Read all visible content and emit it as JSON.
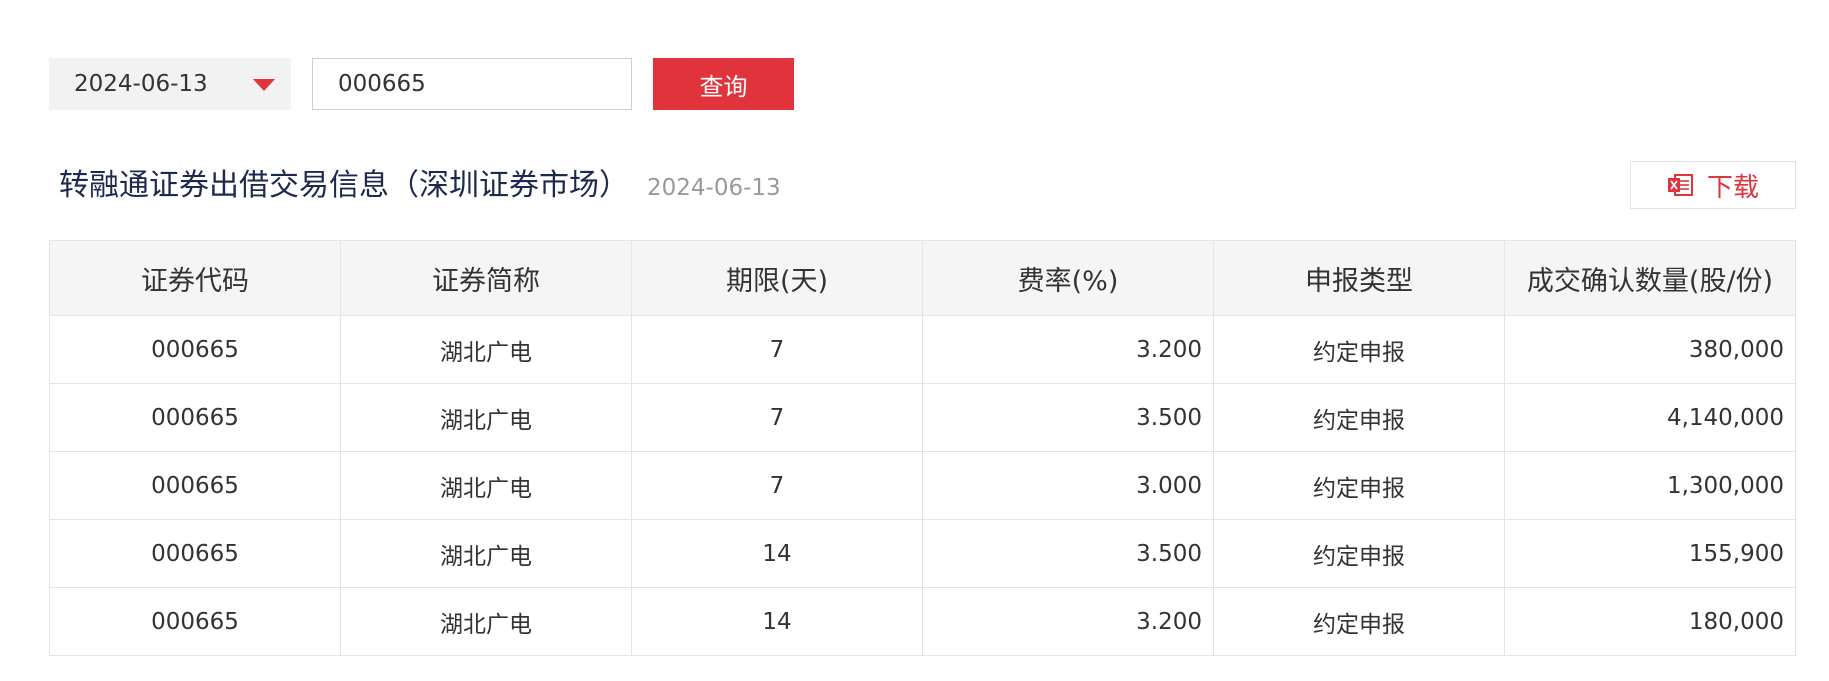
{
  "toolbar": {
    "date_value": "2024-06-13",
    "code_value": "000665",
    "query_label": "查询"
  },
  "header": {
    "title": "转融通证券出借交易信息（深圳证券市场）",
    "date": "2024-06-13",
    "download_label": "下载"
  },
  "colors": {
    "accent": "#e0333b",
    "title": "#1d2a4d",
    "header_bg": "#f5f5f5",
    "border": "#e4e4e4"
  },
  "table": {
    "columns": [
      "证券代码",
      "证券简称",
      "期限(天)",
      "费率(%)",
      "申报类型",
      "成交确认数量(股/份)"
    ],
    "rows": [
      [
        "000665",
        "湖北广电",
        "7",
        "3.200",
        "约定申报",
        "380,000"
      ],
      [
        "000665",
        "湖北广电",
        "7",
        "3.500",
        "约定申报",
        "4,140,000"
      ],
      [
        "000665",
        "湖北广电",
        "7",
        "3.000",
        "约定申报",
        "1,300,000"
      ],
      [
        "000665",
        "湖北广电",
        "14",
        "3.500",
        "约定申报",
        "155,900"
      ],
      [
        "000665",
        "湖北广电",
        "14",
        "3.200",
        "约定申报",
        "180,000"
      ]
    ]
  }
}
